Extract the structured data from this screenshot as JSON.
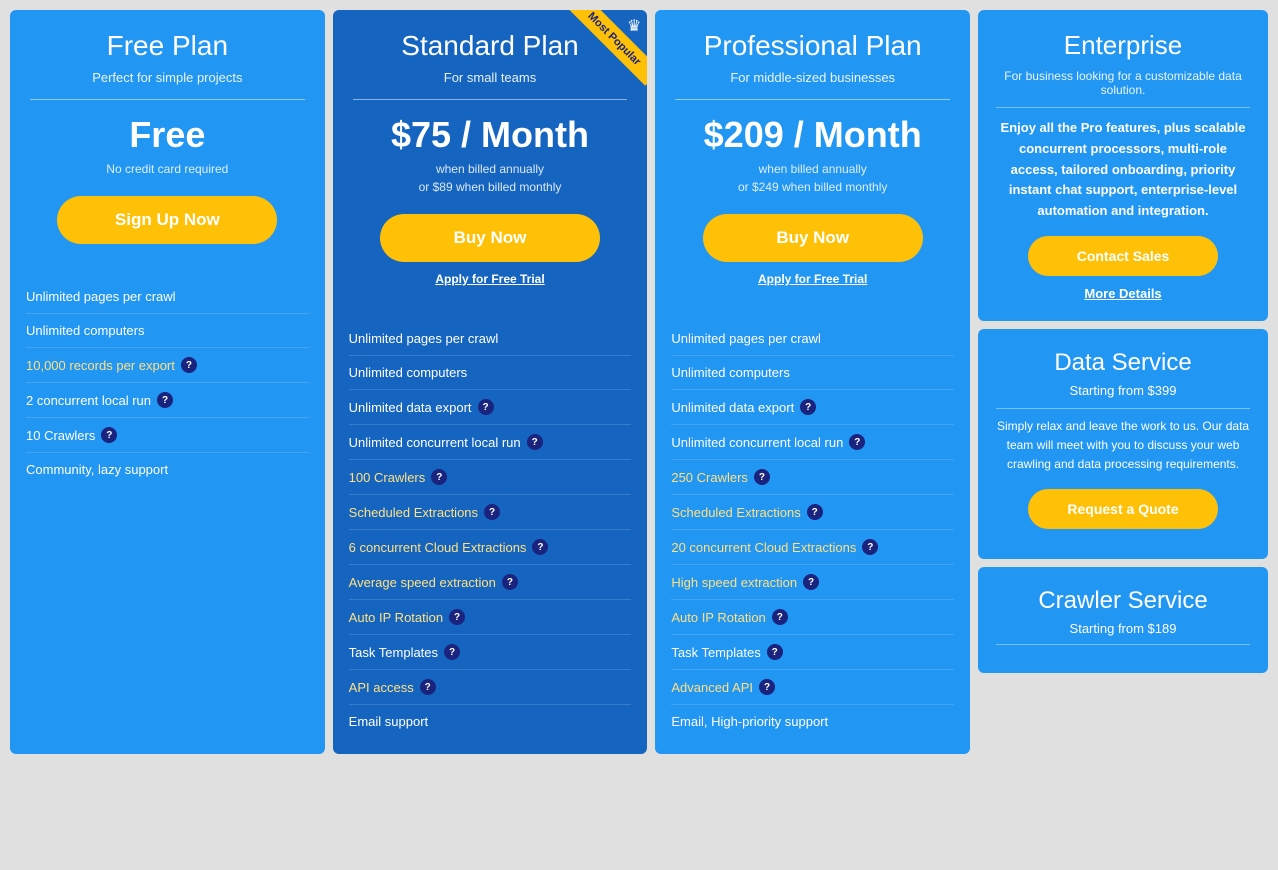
{
  "plans": [
    {
      "id": "free",
      "name": "Free Plan",
      "subtitle": "Perfect for simple projects",
      "price_display": "Free",
      "price_sub": "No credit card required",
      "cta_label": "Sign Up Now",
      "free_trial": null,
      "features": [
        {
          "text": "Unlimited pages per crawl",
          "highlight": false,
          "has_info": false
        },
        {
          "text": "Unlimited computers",
          "highlight": false,
          "has_info": false
        },
        {
          "text": "10,000 records per export",
          "highlight": true,
          "has_info": true
        },
        {
          "text": "2 concurrent local run",
          "highlight": false,
          "has_info": true
        },
        {
          "text": "10 Crawlers",
          "highlight": false,
          "has_info": true
        },
        {
          "text": "Community, lazy support",
          "highlight": false,
          "has_info": false
        }
      ]
    },
    {
      "id": "standard",
      "name": "Standard Plan",
      "subtitle": "For small teams",
      "price_display": "$75 / Month",
      "price_sub": "when billed annually\nor $89 when billed monthly",
      "cta_label": "Buy Now",
      "free_trial": "Apply for Free Trial",
      "most_popular": true,
      "features": [
        {
          "text": "Unlimited pages per crawl",
          "highlight": false,
          "has_info": false
        },
        {
          "text": "Unlimited computers",
          "highlight": false,
          "has_info": false
        },
        {
          "text": "Unlimited data export",
          "highlight": false,
          "has_info": true
        },
        {
          "text": "Unlimited concurrent local run",
          "highlight": false,
          "has_info": true
        },
        {
          "text": "100 Crawlers",
          "highlight": true,
          "has_info": true
        },
        {
          "text": "Scheduled Extractions",
          "highlight": true,
          "has_info": true
        },
        {
          "text": "6 concurrent Cloud Extractions",
          "highlight": true,
          "has_info": true
        },
        {
          "text": "Average speed extraction",
          "highlight": true,
          "has_info": true
        },
        {
          "text": "Auto IP Rotation",
          "highlight": true,
          "has_info": true
        },
        {
          "text": "Task Templates",
          "highlight": false,
          "has_info": true
        },
        {
          "text": "API access",
          "highlight": true,
          "has_info": true
        },
        {
          "text": "Email support",
          "highlight": false,
          "has_info": false
        }
      ]
    },
    {
      "id": "professional",
      "name": "Professional Plan",
      "subtitle": "For middle-sized businesses",
      "price_display": "$209 / Month",
      "price_sub": "when billed annually\nor $249 when billed monthly",
      "cta_label": "Buy Now",
      "free_trial": "Apply for Free Trial",
      "features": [
        {
          "text": "Unlimited pages per crawl",
          "highlight": false,
          "has_info": false
        },
        {
          "text": "Unlimited computers",
          "highlight": false,
          "has_info": false
        },
        {
          "text": "Unlimited data export",
          "highlight": false,
          "has_info": true
        },
        {
          "text": "Unlimited concurrent local run",
          "highlight": false,
          "has_info": true
        },
        {
          "text": "250 Crawlers",
          "highlight": true,
          "has_info": true
        },
        {
          "text": "Scheduled Extractions",
          "highlight": true,
          "has_info": true
        },
        {
          "text": "20 concurrent Cloud Extractions",
          "highlight": true,
          "has_info": true
        },
        {
          "text": "High speed extraction",
          "highlight": true,
          "has_info": true
        },
        {
          "text": "Auto IP Rotation",
          "highlight": true,
          "has_info": true
        },
        {
          "text": "Task Templates",
          "highlight": false,
          "has_info": true
        },
        {
          "text": "Advanced API",
          "highlight": true,
          "has_info": true
        },
        {
          "text": "Email, High-priority support",
          "highlight": false,
          "has_info": false
        }
      ]
    }
  ],
  "enterprise": {
    "title": "Enterprise",
    "subtitle": "For business looking for a customizable data solution.",
    "description": "Enjoy all the Pro features, plus scalable concurrent processors, multi-role access, tailored onboarding, priority instant chat support, enterprise-level automation and integration.",
    "cta_label": "Contact Sales",
    "more_details": "More Details"
  },
  "data_service": {
    "title": "Data Service",
    "price": "Starting from $399",
    "description": "Simply relax and leave the work to us. Our data team will meet with you to discuss your web crawling and data processing requirements.",
    "cta_label": "Request a Quote"
  },
  "crawler_service": {
    "title": "Crawler Service",
    "price": "Starting from $189"
  },
  "ribbon": {
    "crown": "♛",
    "label": "Most Popular"
  }
}
